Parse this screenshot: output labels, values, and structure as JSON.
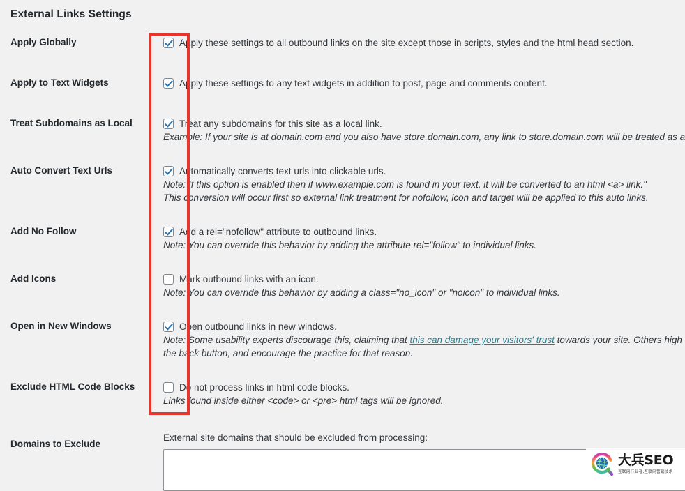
{
  "page": {
    "title": "External Links Settings",
    "background_color": "#f1f1f1",
    "text_color": "#32373c",
    "link_color": "#2e7d8c",
    "accent_checkbox_color": "#2271b1",
    "annotation_color": "#e8342a"
  },
  "rows": [
    {
      "label": "Apply Globally",
      "checkbox_checked": true,
      "checkbox_label": "Apply these settings to all outbound links on the site except those in scripts, styles and the html head section.",
      "notes": []
    },
    {
      "label": "Apply to Text Widgets",
      "checkbox_checked": true,
      "checkbox_label": "Apply these settings to any text widgets in addition to post, page and comments content.",
      "notes": []
    },
    {
      "label": "Treat Subdomains as Local",
      "checkbox_checked": true,
      "checkbox_label": "Treat any subdomains for this site as a local link.",
      "notes": [
        {
          "lead": "Example:",
          "text": " If your site is at domain.com and you also have store.domain.com, any link to store.domain.com will be treated as a"
        }
      ]
    },
    {
      "label": "Auto Convert Text Urls",
      "checkbox_checked": true,
      "checkbox_label": "Automatically converts text urls into clickable urls.",
      "notes": [
        {
          "lead": "Note:",
          "text": " If this option is enabled then if www.example.com is found in your text, it will be converted to an html <a> link.\""
        },
        {
          "lead": "",
          "text": "This conversion will occur first so external link treatment for nofollow, icon and target will be applied to this auto links."
        }
      ]
    },
    {
      "label": "Add No Follow",
      "checkbox_checked": true,
      "checkbox_label": "Add a rel=\"nofollow\" attribute to outbound links.",
      "notes": [
        {
          "lead": "Note:",
          "text": " You can override this behavior by adding the attribute rel=\"follow\" to individual links."
        }
      ]
    },
    {
      "label": "Add Icons",
      "checkbox_checked": false,
      "checkbox_label": "Mark outbound links with an icon.",
      "notes": [
        {
          "lead": "Note:",
          "text": " You can override this behavior by adding a class=\"no_icon\" or \"noicon\" to individual links."
        }
      ]
    },
    {
      "label": "Open in New Windows",
      "checkbox_checked": true,
      "checkbox_label": "Open outbound links in new windows.",
      "notes": [
        {
          "lead": "Note:",
          "text_before": " Some usability experts discourage this, claiming that ",
          "link_text": "this can damage your visitors' trust",
          "text_after": " towards your site. Others high"
        },
        {
          "lead": "",
          "text": "the back button, and encourage the practice for that reason."
        }
      ]
    },
    {
      "label": "Exclude HTML Code Blocks",
      "checkbox_checked": false,
      "checkbox_label": "Do not process links in html code blocks.",
      "notes": [
        {
          "lead": "",
          "text": "Links found inside either <code> or <pre> html tags will be ignored."
        }
      ]
    }
  ],
  "domains_field": {
    "label": "Domains to Exclude",
    "description": "External site domains that should be excluded from processing:",
    "value": "",
    "placeholder": ""
  },
  "watermark": {
    "icon": "globe-magnifier-logo-icon",
    "main_text": "大兵SEO",
    "sub_text": "互联网行业者,互联网营销技术"
  }
}
